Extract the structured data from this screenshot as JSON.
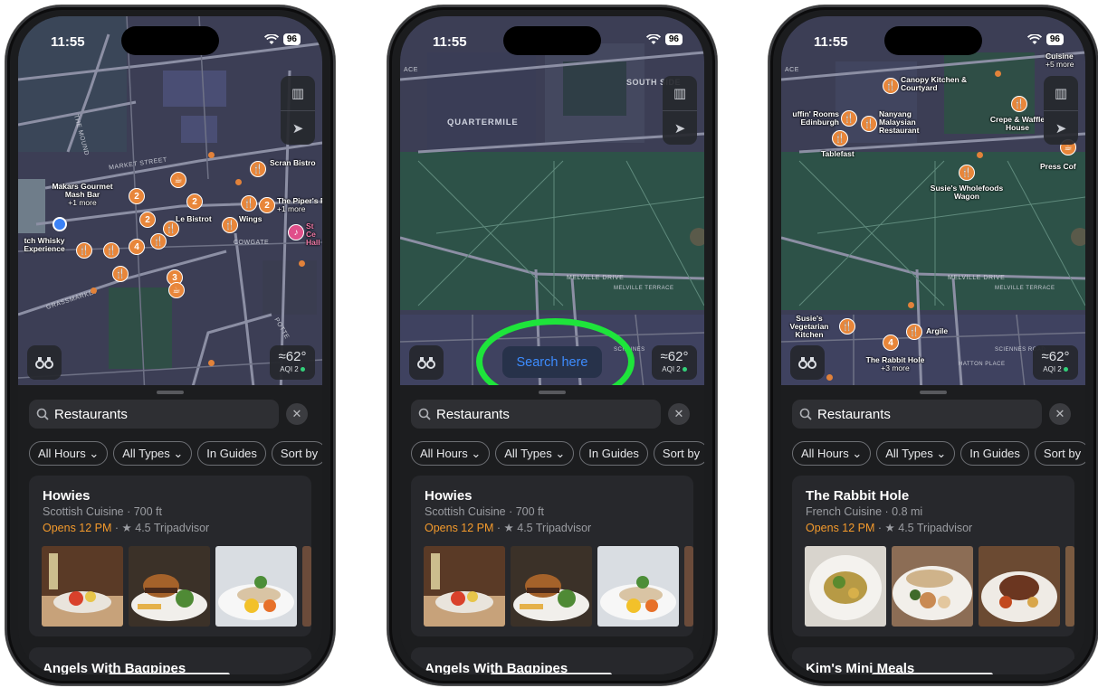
{
  "screens": [
    {
      "status": {
        "time": "11:55",
        "battery": "96"
      },
      "map": {
        "streets": [
          "THE MOUND",
          "MARKET STREET",
          "COWGATE",
          "GRASSMARKET",
          "POTTE"
        ],
        "places": [
          {
            "name": "Makars Gourmet Mash Bar",
            "sub": "+1 more"
          },
          {
            "name": "Scran Bistro",
            "sub": ""
          },
          {
            "name": "The Piper's R",
            "sub": "+1 more"
          },
          {
            "name": "Le Bistrot",
            "sub": ""
          },
          {
            "name": "Wings",
            "sub": ""
          },
          {
            "name": "tch Whisky Experience",
            "sub": ""
          },
          {
            "name": "St Ce Hall",
            "sub": ""
          }
        ],
        "clusters": [
          "2",
          "2",
          "2",
          "2",
          "4",
          "3"
        ]
      },
      "weather": {
        "temp": "62°",
        "aqi": "AQI 2"
      },
      "search": {
        "query": "Restaurants"
      },
      "filters": [
        "All Hours ⌄",
        "All Types ⌄",
        "In Guides",
        "Sort by"
      ],
      "result": {
        "name": "Howies",
        "meta": "Scottish Cuisine · 700 ft",
        "opens": "Opens 12 PM",
        "rating": "· ★ 4.5 Tripadvisor"
      },
      "next_result": "Angels With Bagpipes"
    },
    {
      "status": {
        "time": "11:55",
        "battery": "96"
      },
      "map": {
        "streets": [
          "SOUTH SIDE",
          "ACE",
          "QUARTERMILE",
          "MELVILLE DRIVE",
          "MELVILLE TERRACE",
          "SCIENNES"
        ],
        "search_here": "Search here"
      },
      "weather": {
        "temp": "62°",
        "aqi": "AQI 2"
      },
      "search": {
        "query": "Restaurants"
      },
      "filters": [
        "All Hours ⌄",
        "All Types ⌄",
        "In Guides",
        "Sort by"
      ],
      "result": {
        "name": "Howies",
        "meta": "Scottish Cuisine · 700 ft",
        "opens": "Opens 12 PM",
        "rating": "· ★ 4.5 Tripadvisor"
      },
      "next_result": "Angels With Bagpipes"
    },
    {
      "status": {
        "time": "11:55",
        "battery": "96"
      },
      "map": {
        "streets": [
          "ACE",
          "MELVILLE DRIVE",
          "MELVILLE TERRACE",
          "SCIENNES ROAD",
          "HATTON PLACE"
        ],
        "places": [
          {
            "name": "Canopy Kitchen & Courtyard",
            "sub": ""
          },
          {
            "name": "uffin' Rooms Edinburgh",
            "sub": ""
          },
          {
            "name": "Nanyang Malaysian Restaurant",
            "sub": ""
          },
          {
            "name": "Tablefast",
            "sub": ""
          },
          {
            "name": "Crepe & Waffle House",
            "sub": ""
          },
          {
            "name": "Press Cof",
            "sub": ""
          },
          {
            "name": "Susie's Wholefoods Wagon",
            "sub": ""
          },
          {
            "name": "Susie's Vegetarian Kitchen",
            "sub": ""
          },
          {
            "name": "Argile",
            "sub": ""
          },
          {
            "name": "The Rabbit Hole",
            "sub": "+3 more"
          },
          {
            "name": "Cuisine",
            "sub": "+5 more"
          }
        ],
        "clusters": [
          "4"
        ]
      },
      "weather": {
        "temp": "62°",
        "aqi": "AQI 2"
      },
      "search": {
        "query": "Restaurants"
      },
      "filters": [
        "All Hours ⌄",
        "All Types ⌄",
        "In Guides",
        "Sort by"
      ],
      "result": {
        "name": "The Rabbit Hole",
        "meta": "French Cuisine · 0.8 mi",
        "opens": "Opens 12 PM",
        "rating": "· ★ 4.5 Tripadvisor"
      },
      "next_result": "Kim's Mini Meals"
    }
  ],
  "colors": {
    "map_base": "#3c3e55",
    "park": "#2d5248",
    "poi": "#e8863a",
    "accent": "#3d8cff",
    "highlight_ring": "#1ee43b",
    "open_text": "#f39a2c"
  },
  "icons": {
    "map_mode": "map-icon",
    "locate": "location-arrow-icon",
    "look_around": "binoculars-icon",
    "search": "magnifier-icon",
    "close": "close-icon",
    "weather": "wind-icon"
  }
}
